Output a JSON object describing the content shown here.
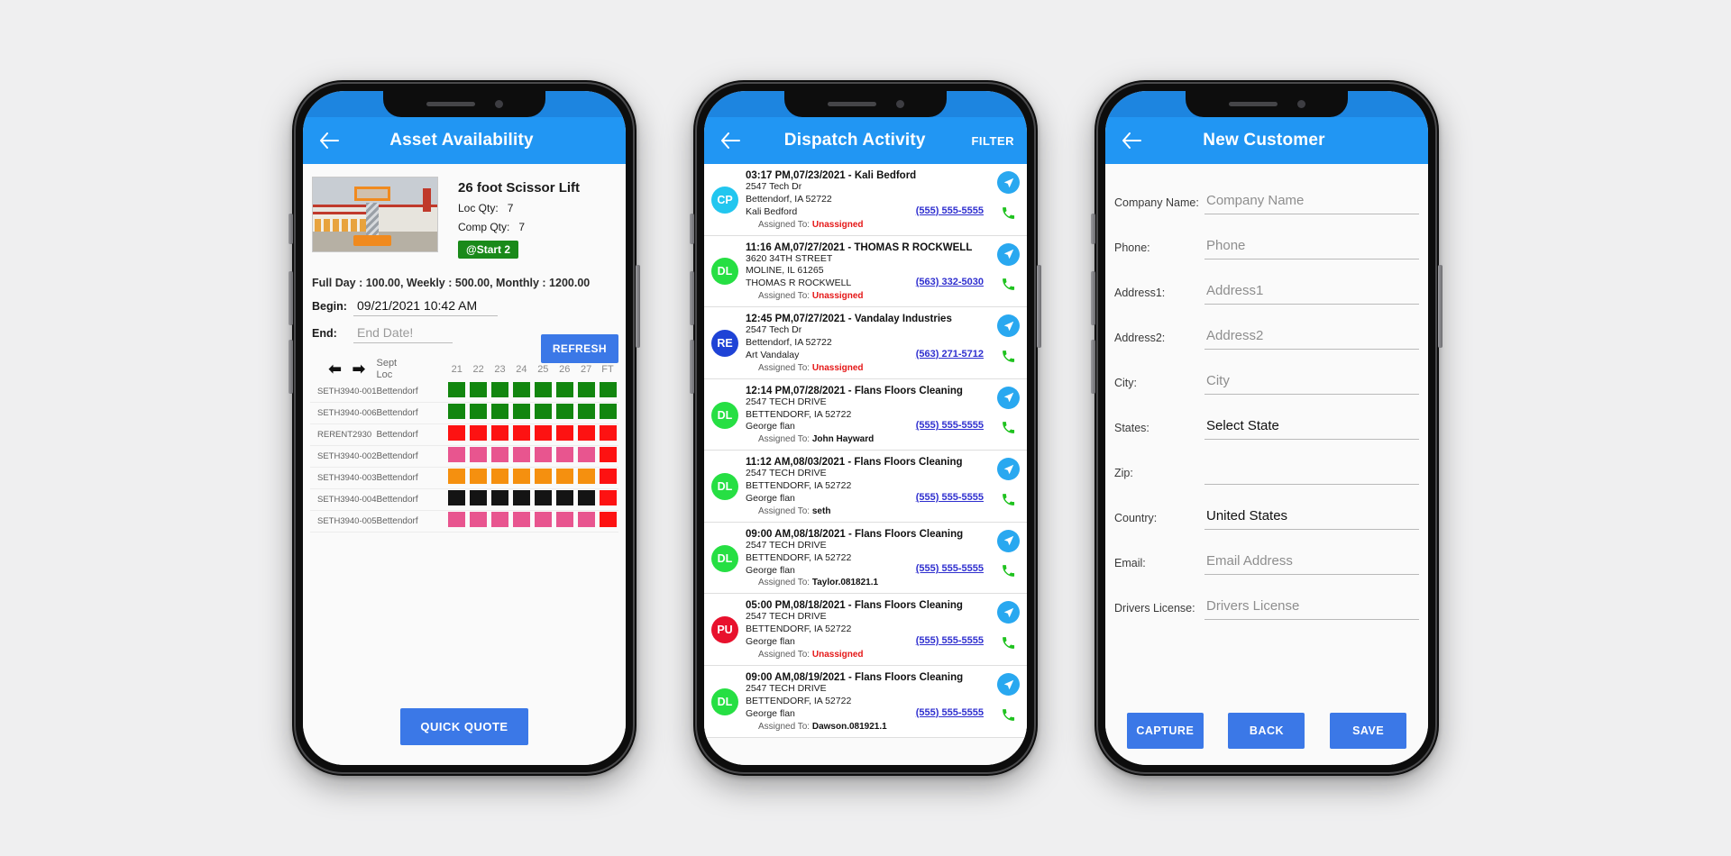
{
  "phone1": {
    "appbar": {
      "back_icon": "arrow-left-icon",
      "title": "Asset Availability"
    },
    "asset": {
      "name": "26 foot Scissor Lift",
      "loc_qty_label": "Loc Qty:",
      "loc_qty_value": "7",
      "comp_qty_label": "Comp Qty:",
      "comp_qty_value": "7",
      "start_badge": "@Start  2",
      "start_badge_color": "#1a8a1a",
      "photo_icon": "scissor-lift-photo"
    },
    "rates": "Full Day : 100.00, Weekly : 500.00, Monthly : 1200.00",
    "begin": {
      "label": "Begin:",
      "value": "09/21/2021 10:42 AM"
    },
    "end": {
      "label": "End:",
      "placeholder": "End Date!"
    },
    "refresh_label": "REFRESH",
    "grid": {
      "prev_icon": "arrow-left-icon",
      "next_icon": "arrow-right-icon",
      "month_label": "Sept",
      "loc_label": "Loc",
      "days": [
        "21",
        "22",
        "23",
        "24",
        "25",
        "26",
        "27",
        "FT"
      ],
      "rows": [
        {
          "id": "SETH3940-001",
          "loc": "Bettendorf",
          "colors": [
            "#12860f",
            "#12860f",
            "#12860f",
            "#12860f",
            "#12860f",
            "#12860f",
            "#12860f",
            "#12860f"
          ]
        },
        {
          "id": "SETH3940-006",
          "loc": "Bettendorf",
          "colors": [
            "#12860f",
            "#12860f",
            "#12860f",
            "#12860f",
            "#12860f",
            "#12860f",
            "#12860f",
            "#12860f"
          ]
        },
        {
          "id": "RERENT2930",
          "loc": "Bettendorf",
          "colors": [
            "#fd1212",
            "#fd1212",
            "#fd1212",
            "#fd1212",
            "#fd1212",
            "#fd1212",
            "#fd1212",
            "#fd1212"
          ]
        },
        {
          "id": "SETH3940-002",
          "loc": "Bettendorf",
          "colors": [
            "#e8558f",
            "#e8558f",
            "#e8558f",
            "#e8558f",
            "#e8558f",
            "#e8558f",
            "#e8558f",
            "#fd1212"
          ]
        },
        {
          "id": "SETH3940-003",
          "loc": "Bettendorf",
          "colors": [
            "#f5900f",
            "#f5900f",
            "#f5900f",
            "#f5900f",
            "#f5900f",
            "#f5900f",
            "#f5900f",
            "#fd1212"
          ]
        },
        {
          "id": "SETH3940-004",
          "loc": "Bettendorf",
          "colors": [
            "#141414",
            "#141414",
            "#141414",
            "#141414",
            "#141414",
            "#141414",
            "#141414",
            "#fd1212"
          ]
        },
        {
          "id": "SETH3940-005",
          "loc": "Bettendorf",
          "colors": [
            "#e8558f",
            "#e8558f",
            "#e8558f",
            "#e8558f",
            "#e8558f",
            "#e8558f",
            "#e8558f",
            "#fd1212"
          ]
        }
      ]
    },
    "quick_quote_label": "QUICK QUOTE"
  },
  "phone2": {
    "appbar": {
      "back_icon": "arrow-left-icon",
      "title": "Dispatch Activity",
      "filter_label": "FILTER"
    },
    "assigned_to_label": "Assigned To:",
    "nav_icon": "navigation-arrow-icon",
    "call_icon": "phone-call-icon",
    "items": [
      {
        "avatar": "CP",
        "avatar_color": "#22c6ef",
        "header": "03:17 PM,07/23/2021 - Kali Bedford",
        "address1": "2547 Tech Dr",
        "address2": "Bettendorf, IA   52722",
        "contact": "Kali Bedford",
        "assigned_to": "Unassigned",
        "unassigned": true,
        "phone": "(555) 555-5555"
      },
      {
        "avatar": "DL",
        "avatar_color": "#26df43",
        "header": "11:16 AM,07/27/2021 - THOMAS R ROCKWELL",
        "address1": "3620 34TH STREET",
        "address2": "MOLINE, IL  61265",
        "contact": "THOMAS R ROCKWELL",
        "assigned_to": "Unassigned",
        "unassigned": true,
        "phone": "(563) 332-5030"
      },
      {
        "avatar": "RE",
        "avatar_color": "#1f43d6",
        "header": "12:45 PM,07/27/2021 - Vandalay Industries",
        "address1": "2547 Tech Dr",
        "address2": "Bettendorf, IA   52722",
        "contact": "Art Vandalay",
        "assigned_to": "Unassigned",
        "unassigned": true,
        "phone": "(563) 271-5712"
      },
      {
        "avatar": "DL",
        "avatar_color": "#26df43",
        "header": "12:14 PM,07/28/2021 - Flans Floors Cleaning",
        "address1": "2547 TECH DRIVE",
        "address2": "BETTENDORF, IA  52722",
        "contact": "George flan",
        "assigned_to": "John Hayward",
        "unassigned": false,
        "phone": "(555) 555-5555"
      },
      {
        "avatar": "DL",
        "avatar_color": "#26df43",
        "header": "11:12 AM,08/03/2021 - Flans Floors Cleaning",
        "address1": "2547 TECH DRIVE",
        "address2": "BETTENDORF, IA  52722",
        "contact": "George flan",
        "assigned_to": "seth",
        "unassigned": false,
        "phone": "(555) 555-5555"
      },
      {
        "avatar": "DL",
        "avatar_color": "#26df43",
        "header": "09:00 AM,08/18/2021 - Flans Floors Cleaning",
        "address1": "2547 TECH DRIVE",
        "address2": "BETTENDORF, IA  52722",
        "contact": "George flan",
        "assigned_to": "Taylor.081821.1",
        "unassigned": false,
        "phone": "(555) 555-5555"
      },
      {
        "avatar": "PU",
        "avatar_color": "#e8112d",
        "header": "05:00 PM,08/18/2021 - Flans Floors Cleaning",
        "address1": "2547 TECH DRIVE",
        "address2": "BETTENDORF, IA  52722",
        "contact": "George flan",
        "assigned_to": "Unassigned",
        "unassigned": true,
        "phone": "(555) 555-5555"
      },
      {
        "avatar": "DL",
        "avatar_color": "#26df43",
        "header": "09:00 AM,08/19/2021 - Flans Floors Cleaning",
        "address1": "2547 TECH DRIVE",
        "address2": "BETTENDORF, IA  52722",
        "contact": "George flan",
        "assigned_to": "Dawson.081921.1",
        "unassigned": false,
        "phone": "(555) 555-5555"
      }
    ]
  },
  "phone3": {
    "appbar": {
      "back_icon": "arrow-left-icon",
      "title": "New Customer"
    },
    "fields": [
      {
        "label": "Company Name:",
        "value": "Company Name",
        "filled": false
      },
      {
        "label": "Phone:",
        "value": "Phone",
        "filled": false
      },
      {
        "label": "Address1:",
        "value": "Address1",
        "filled": false
      },
      {
        "label": "Address2:",
        "value": "Address2",
        "filled": false
      },
      {
        "label": "City:",
        "value": "City",
        "filled": false
      },
      {
        "label": "States:",
        "value": "Select State",
        "filled": true
      },
      {
        "label": "Zip:",
        "value": "",
        "filled": false
      },
      {
        "label": "Country:",
        "value": "United States",
        "filled": true
      },
      {
        "label": "Email:",
        "value": "Email Address",
        "filled": false
      },
      {
        "label": "Drivers License:",
        "value": "Drivers License",
        "filled": false
      }
    ],
    "buttons": [
      {
        "label": "CAPTURE"
      },
      {
        "label": "BACK"
      },
      {
        "label": "SAVE"
      }
    ]
  },
  "theme": {
    "appbar_color": "#2196f3",
    "statusbar_color": "#1d85e0",
    "button_color": "#3b78e7",
    "link_color": "#2f2fcf",
    "danger_color": "#e51717",
    "page_bg": "#efeff0"
  }
}
